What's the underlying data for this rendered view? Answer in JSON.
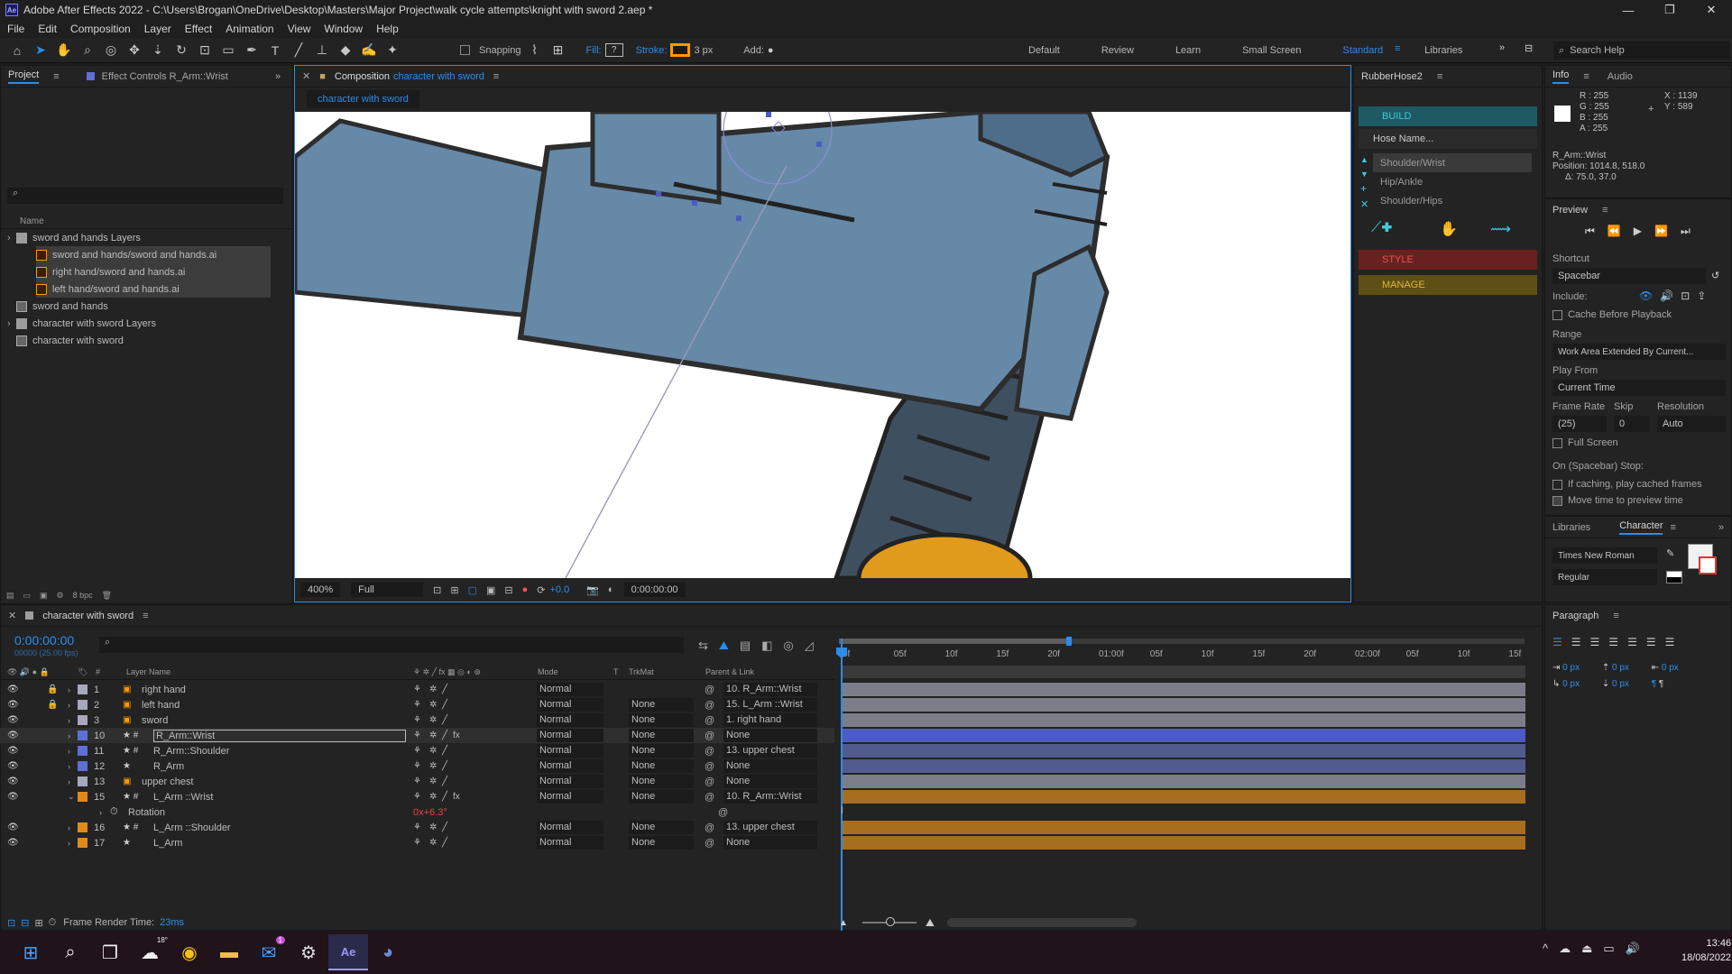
{
  "window": {
    "app_icon": "Ae",
    "title": "Adobe After Effects 2022 - C:\\Users\\Brogan\\OneDrive\\Desktop\\Masters\\Major Project\\walk cycle attempts\\knight with sword 2.aep *",
    "minimize": "—",
    "maximize": "❐",
    "close": "✕"
  },
  "menu": [
    "File",
    "Edit",
    "Composition",
    "Layer",
    "Effect",
    "Animation",
    "View",
    "Window",
    "Help"
  ],
  "toolbar": {
    "snapping": "Snapping",
    "fill": "Fill:",
    "fill_value": "?",
    "stroke": "Stroke:",
    "stroke_px": "3 px",
    "add": "Add:",
    "workspaces": [
      "Default",
      "Review",
      "Learn",
      "Small Screen",
      "Standard",
      "Libraries"
    ],
    "active_workspace": "Standard",
    "search_help": "Search Help"
  },
  "project": {
    "tab_project": "Project",
    "tab_effect_controls": "Effect Controls R_Arm::Wrist",
    "col_name": "Name",
    "items": [
      {
        "name": "sword and hands Layers",
        "type": "folder",
        "selected": false,
        "indent": 0
      },
      {
        "name": "sword and hands/sword and hands.ai",
        "type": "ai",
        "selected": true,
        "indent": 1
      },
      {
        "name": "right hand/sword and hands.ai",
        "type": "ai",
        "selected": true,
        "indent": 1
      },
      {
        "name": "left hand/sword and hands.ai",
        "type": "ai",
        "selected": true,
        "indent": 1
      },
      {
        "name": "sword and hands",
        "type": "comp",
        "selected": false,
        "indent": 0
      },
      {
        "name": "character with sword Layers",
        "type": "folder",
        "selected": false,
        "indent": 0
      },
      {
        "name": "character with sword",
        "type": "comp",
        "selected": false,
        "indent": 0
      }
    ],
    "bpc": "8 bpc"
  },
  "composition": {
    "tab_label": "Composition",
    "comp_name": "character with sword",
    "breadcrumb": "character with sword",
    "zoom": "400%",
    "resolution": "Full",
    "exposure": "+0.0",
    "timecode": "0:00:00:00"
  },
  "rubberhose": {
    "title": "RubberHose2",
    "build": "BUILD",
    "hose_name": "Hose Name...",
    "items": [
      "Shoulder/Wrist",
      "Hip/Ankle",
      "Shoulder/Hips"
    ],
    "style": "STYLE",
    "manage": "MANAGE",
    "colors": {
      "build": "#1f5a63",
      "style": "#6b2020",
      "manage": "#5e4f14"
    }
  },
  "info": {
    "tab_info": "Info",
    "tab_audio": "Audio",
    "r": "R : 255",
    "g": "G : 255",
    "b": "B : 255",
    "a": "A : 255",
    "x": "X : 1139",
    "y": "Y : 589",
    "layer": "R_Arm::Wrist",
    "position": "Position: 1014.8, 518.0",
    "delta": "Δ: 75.0, 37.0"
  },
  "preview": {
    "title": "Preview",
    "shortcut_label": "Shortcut",
    "shortcut": "Spacebar",
    "include": "Include:",
    "cache": "Cache Before Playback",
    "range_label": "Range",
    "range": "Work Area Extended By Current...",
    "play_from_label": "Play From",
    "play_from": "Current Time",
    "frame_rate_label": "Frame Rate",
    "skip_label": "Skip",
    "resolution_label": "Resolution",
    "frame_rate": "(25)",
    "skip": "0",
    "resolution": "Auto",
    "full_screen": "Full Screen",
    "on_stop": "On (Spacebar) Stop:",
    "if_caching": "If caching, play cached frames",
    "move_time": "Move time to preview time"
  },
  "character": {
    "tab_libraries": "Libraries",
    "tab_character": "Character",
    "font": "Times New Roman",
    "style": "Regular"
  },
  "paragraph": {
    "title": "Paragraph",
    "values": [
      "0 px",
      "0 px",
      "0 px",
      "0 px",
      "0 px"
    ]
  },
  "timeline": {
    "comp_name": "character with sword",
    "timecode": "0:00:00:00",
    "fps_sub": "00000 (25.00 fps)",
    "col_layer_name": "Layer Name",
    "col_mode": "Mode",
    "col_t": "T",
    "col_trkmat": "TrkMat",
    "col_parent": "Parent & Link",
    "ruler": [
      "0f",
      "05f",
      "10f",
      "15f",
      "20f",
      "01:00f",
      "05f",
      "10f",
      "15f",
      "20f",
      "02:00f",
      "05f",
      "10f",
      "15f"
    ],
    "frame_render_time_label": "Frame Render Time:",
    "frame_render_time": "23ms",
    "layers": [
      {
        "num": "1",
        "name": "right hand",
        "label": "#a7a7bd",
        "mode": "Normal",
        "trkmat": "",
        "parent": "10. R_Arm::Wrist",
        "locked": true,
        "icon": "ai",
        "bar": "#7d7d8a",
        "fx": false
      },
      {
        "num": "2",
        "name": "left hand",
        "label": "#a7a7bd",
        "mode": "Normal",
        "trkmat": "None",
        "parent": "15. L_Arm ::Wrist",
        "locked": true,
        "icon": "ai",
        "bar": "#7d7d8a",
        "fx": false
      },
      {
        "num": "3",
        "name": "sword",
        "label": "#a7a7bd",
        "mode": "Normal",
        "trkmat": "None",
        "parent": "1. right hand",
        "locked": false,
        "icon": "ai",
        "bar": "#7d7d8a",
        "fx": false
      },
      {
        "num": "10",
        "name": "R_Arm::Wrist",
        "label": "#5f6fd6",
        "mode": "Normal",
        "trkmat": "None",
        "parent": "None",
        "locked": false,
        "icon": "shape",
        "bar": "#4c5bc4",
        "fx": true,
        "selected": true
      },
      {
        "num": "11",
        "name": "R_Arm::Shoulder",
        "label": "#5f6fd6",
        "mode": "Normal",
        "trkmat": "None",
        "parent": "13. upper chest",
        "locked": false,
        "icon": "shape",
        "bar": "#525b8e",
        "fx": false
      },
      {
        "num": "12",
        "name": "R_Arm",
        "label": "#5f6fd6",
        "mode": "Normal",
        "trkmat": "None",
        "parent": "None",
        "locked": false,
        "icon": "star",
        "bar": "#525b8e",
        "fx": false
      },
      {
        "num": "13",
        "name": "upper chest",
        "label": "#a7a7bd",
        "mode": "Normal",
        "trkmat": "None",
        "parent": "None",
        "locked": false,
        "icon": "ai",
        "bar": "#7d7d8a",
        "fx": false
      },
      {
        "num": "15",
        "name": "L_Arm ::Wrist",
        "label": "#e08a1c",
        "mode": "Normal",
        "trkmat": "None",
        "parent": "10. R_Arm::Wrist",
        "locked": false,
        "icon": "shape",
        "bar": "#a76e1f",
        "fx": true,
        "expanded": true
      },
      {
        "num": "16",
        "name": "L_Arm ::Shoulder",
        "label": "#e08a1c",
        "mode": "Normal",
        "trkmat": "None",
        "parent": "13. upper chest",
        "locked": false,
        "icon": "shape",
        "bar": "#a76e1f",
        "fx": false
      },
      {
        "num": "17",
        "name": "L_Arm",
        "label": "#e08a1c",
        "mode": "Normal",
        "trkmat": "None",
        "parent": "None",
        "locked": false,
        "icon": "star",
        "bar": "#a76e1f",
        "fx": false
      }
    ],
    "rotation": {
      "label": "Rotation",
      "value": "0x+6.3°"
    }
  },
  "taskbar": {
    "weather": "18°",
    "mail_badge": "1",
    "time": "13:46",
    "date": "18/08/2022"
  }
}
